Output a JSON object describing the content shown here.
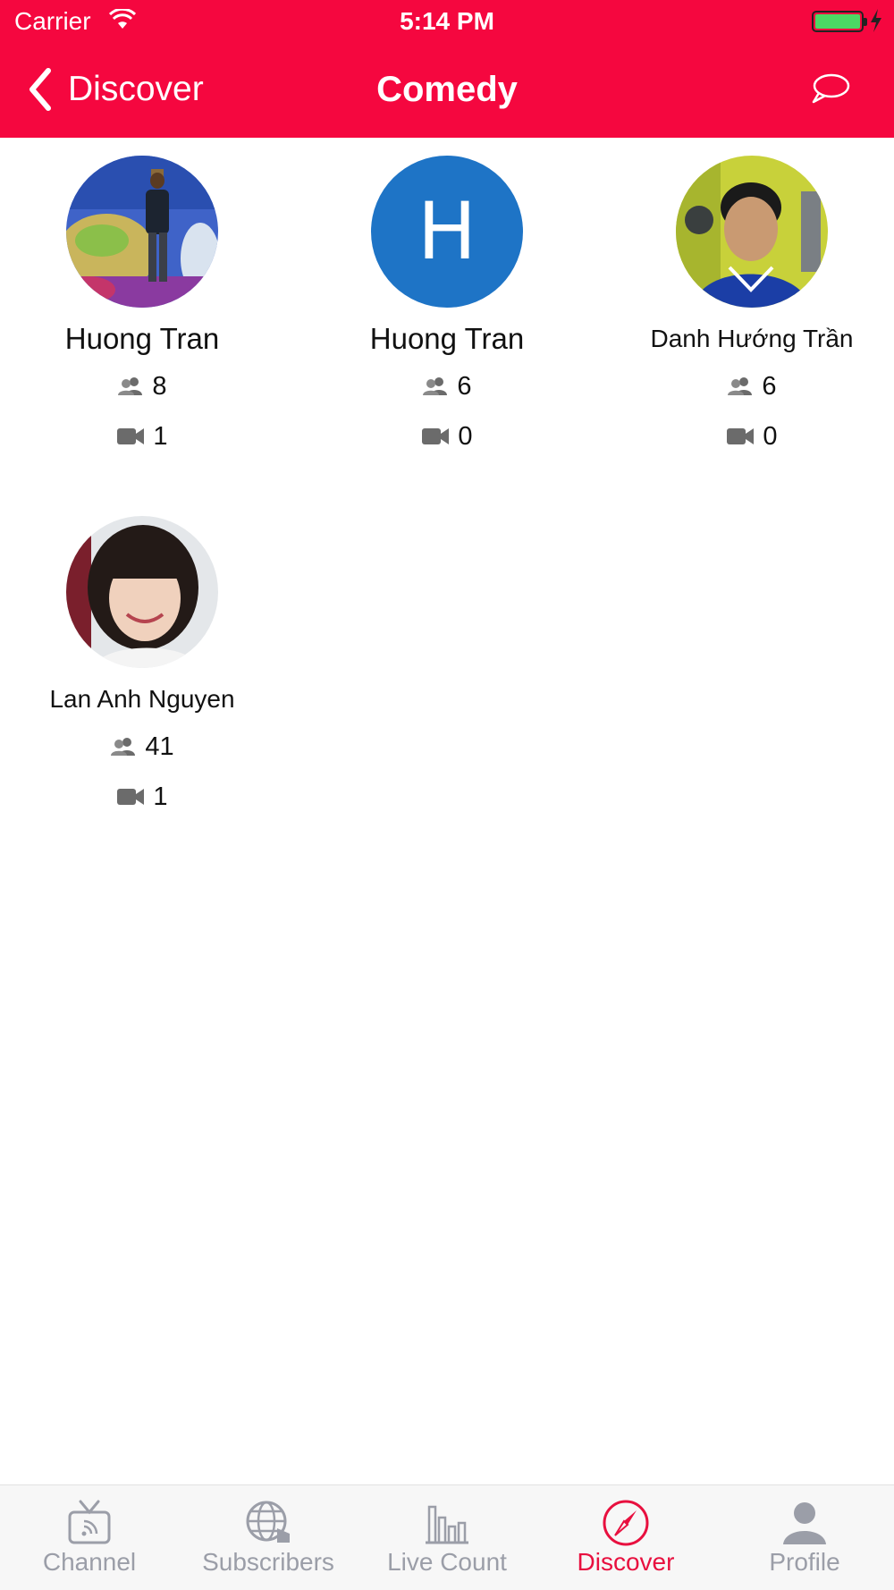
{
  "status_bar": {
    "carrier": "Carrier",
    "time": "5:14 PM"
  },
  "nav": {
    "back_label": "Discover",
    "title": "Comedy"
  },
  "users": [
    {
      "name": "Huong Tran",
      "subscribers": "8",
      "videos": "1",
      "avatar": "photo"
    },
    {
      "name": "Huong Tran",
      "subscribers": "6",
      "videos": "0",
      "avatar": "letter",
      "initial": "H"
    },
    {
      "name": "Danh Hướng Trần",
      "subscribers": "6",
      "videos": "0",
      "avatar": "photo"
    },
    {
      "name": "Lan Anh Nguyen",
      "subscribers": "41",
      "videos": "1",
      "avatar": "photo"
    }
  ],
  "tabs": [
    {
      "label": "Channel",
      "icon": "tv-icon"
    },
    {
      "label": "Subscribers",
      "icon": "globe-icon"
    },
    {
      "label": "Live Count",
      "icon": "bar-chart-icon"
    },
    {
      "label": "Discover",
      "icon": "compass-icon",
      "active": true
    },
    {
      "label": "Profile",
      "icon": "person-icon"
    }
  ],
  "colors": {
    "brand": "#f5073f",
    "tab_active": "#e8103f",
    "tab_inactive": "#9b9ea8",
    "avatar_letter_bg": "#1e74c6"
  }
}
